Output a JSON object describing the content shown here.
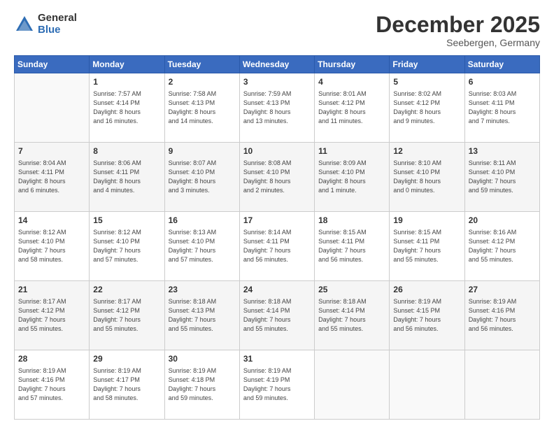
{
  "logo": {
    "general": "General",
    "blue": "Blue"
  },
  "header": {
    "title": "December 2025",
    "subtitle": "Seebergen, Germany"
  },
  "weekdays": [
    "Sunday",
    "Monday",
    "Tuesday",
    "Wednesday",
    "Thursday",
    "Friday",
    "Saturday"
  ],
  "weeks": [
    [
      {
        "day": "",
        "sunrise": "",
        "sunset": "",
        "daylight": ""
      },
      {
        "day": "1",
        "sunrise": "Sunrise: 7:57 AM",
        "sunset": "Sunset: 4:14 PM",
        "daylight": "Daylight: 8 hours and 16 minutes."
      },
      {
        "day": "2",
        "sunrise": "Sunrise: 7:58 AM",
        "sunset": "Sunset: 4:13 PM",
        "daylight": "Daylight: 8 hours and 14 minutes."
      },
      {
        "day": "3",
        "sunrise": "Sunrise: 7:59 AM",
        "sunset": "Sunset: 4:13 PM",
        "daylight": "Daylight: 8 hours and 13 minutes."
      },
      {
        "day": "4",
        "sunrise": "Sunrise: 8:01 AM",
        "sunset": "Sunset: 4:12 PM",
        "daylight": "Daylight: 8 hours and 11 minutes."
      },
      {
        "day": "5",
        "sunrise": "Sunrise: 8:02 AM",
        "sunset": "Sunset: 4:12 PM",
        "daylight": "Daylight: 8 hours and 9 minutes."
      },
      {
        "day": "6",
        "sunrise": "Sunrise: 8:03 AM",
        "sunset": "Sunset: 4:11 PM",
        "daylight": "Daylight: 8 hours and 7 minutes."
      }
    ],
    [
      {
        "day": "7",
        "sunrise": "Sunrise: 8:04 AM",
        "sunset": "Sunset: 4:11 PM",
        "daylight": "Daylight: 8 hours and 6 minutes."
      },
      {
        "day": "8",
        "sunrise": "Sunrise: 8:06 AM",
        "sunset": "Sunset: 4:11 PM",
        "daylight": "Daylight: 8 hours and 4 minutes."
      },
      {
        "day": "9",
        "sunrise": "Sunrise: 8:07 AM",
        "sunset": "Sunset: 4:10 PM",
        "daylight": "Daylight: 8 hours and 3 minutes."
      },
      {
        "day": "10",
        "sunrise": "Sunrise: 8:08 AM",
        "sunset": "Sunset: 4:10 PM",
        "daylight": "Daylight: 8 hours and 2 minutes."
      },
      {
        "day": "11",
        "sunrise": "Sunrise: 8:09 AM",
        "sunset": "Sunset: 4:10 PM",
        "daylight": "Daylight: 8 hours and 1 minute."
      },
      {
        "day": "12",
        "sunrise": "Sunrise: 8:10 AM",
        "sunset": "Sunset: 4:10 PM",
        "daylight": "Daylight: 8 hours and 0 minutes."
      },
      {
        "day": "13",
        "sunrise": "Sunrise: 8:11 AM",
        "sunset": "Sunset: 4:10 PM",
        "daylight": "Daylight: 7 hours and 59 minutes."
      }
    ],
    [
      {
        "day": "14",
        "sunrise": "Sunrise: 8:12 AM",
        "sunset": "Sunset: 4:10 PM",
        "daylight": "Daylight: 7 hours and 58 minutes."
      },
      {
        "day": "15",
        "sunrise": "Sunrise: 8:12 AM",
        "sunset": "Sunset: 4:10 PM",
        "daylight": "Daylight: 7 hours and 57 minutes."
      },
      {
        "day": "16",
        "sunrise": "Sunrise: 8:13 AM",
        "sunset": "Sunset: 4:10 PM",
        "daylight": "Daylight: 7 hours and 57 minutes."
      },
      {
        "day": "17",
        "sunrise": "Sunrise: 8:14 AM",
        "sunset": "Sunset: 4:11 PM",
        "daylight": "Daylight: 7 hours and 56 minutes."
      },
      {
        "day": "18",
        "sunrise": "Sunrise: 8:15 AM",
        "sunset": "Sunset: 4:11 PM",
        "daylight": "Daylight: 7 hours and 56 minutes."
      },
      {
        "day": "19",
        "sunrise": "Sunrise: 8:15 AM",
        "sunset": "Sunset: 4:11 PM",
        "daylight": "Daylight: 7 hours and 55 minutes."
      },
      {
        "day": "20",
        "sunrise": "Sunrise: 8:16 AM",
        "sunset": "Sunset: 4:12 PM",
        "daylight": "Daylight: 7 hours and 55 minutes."
      }
    ],
    [
      {
        "day": "21",
        "sunrise": "Sunrise: 8:17 AM",
        "sunset": "Sunset: 4:12 PM",
        "daylight": "Daylight: 7 hours and 55 minutes."
      },
      {
        "day": "22",
        "sunrise": "Sunrise: 8:17 AM",
        "sunset": "Sunset: 4:12 PM",
        "daylight": "Daylight: 7 hours and 55 minutes."
      },
      {
        "day": "23",
        "sunrise": "Sunrise: 8:18 AM",
        "sunset": "Sunset: 4:13 PM",
        "daylight": "Daylight: 7 hours and 55 minutes."
      },
      {
        "day": "24",
        "sunrise": "Sunrise: 8:18 AM",
        "sunset": "Sunset: 4:14 PM",
        "daylight": "Daylight: 7 hours and 55 minutes."
      },
      {
        "day": "25",
        "sunrise": "Sunrise: 8:18 AM",
        "sunset": "Sunset: 4:14 PM",
        "daylight": "Daylight: 7 hours and 55 minutes."
      },
      {
        "day": "26",
        "sunrise": "Sunrise: 8:19 AM",
        "sunset": "Sunset: 4:15 PM",
        "daylight": "Daylight: 7 hours and 56 minutes."
      },
      {
        "day": "27",
        "sunrise": "Sunrise: 8:19 AM",
        "sunset": "Sunset: 4:16 PM",
        "daylight": "Daylight: 7 hours and 56 minutes."
      }
    ],
    [
      {
        "day": "28",
        "sunrise": "Sunrise: 8:19 AM",
        "sunset": "Sunset: 4:16 PM",
        "daylight": "Daylight: 7 hours and 57 minutes."
      },
      {
        "day": "29",
        "sunrise": "Sunrise: 8:19 AM",
        "sunset": "Sunset: 4:17 PM",
        "daylight": "Daylight: 7 hours and 58 minutes."
      },
      {
        "day": "30",
        "sunrise": "Sunrise: 8:19 AM",
        "sunset": "Sunset: 4:18 PM",
        "daylight": "Daylight: 7 hours and 59 minutes."
      },
      {
        "day": "31",
        "sunrise": "Sunrise: 8:19 AM",
        "sunset": "Sunset: 4:19 PM",
        "daylight": "Daylight: 7 hours and 59 minutes."
      },
      {
        "day": "",
        "sunrise": "",
        "sunset": "",
        "daylight": ""
      },
      {
        "day": "",
        "sunrise": "",
        "sunset": "",
        "daylight": ""
      },
      {
        "day": "",
        "sunrise": "",
        "sunset": "",
        "daylight": ""
      }
    ]
  ]
}
